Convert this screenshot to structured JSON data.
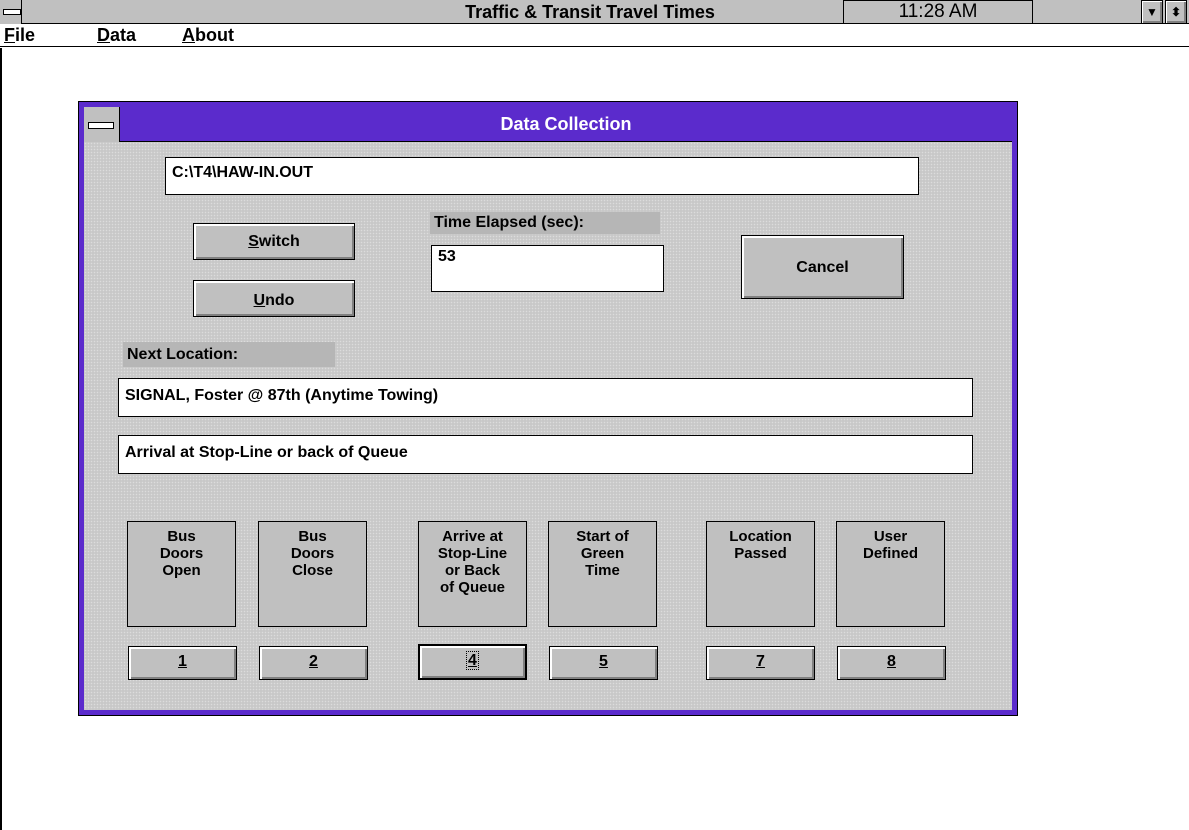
{
  "window": {
    "title": "Traffic & Transit Travel Times",
    "clock": "11:28 AM",
    "min_glyph": "▼",
    "max_glyph": "⬍"
  },
  "menu": [
    {
      "label": "File",
      "mnemonic": "F",
      "rest": "ile"
    },
    {
      "label": "Data",
      "mnemonic": "D",
      "rest": "ata"
    },
    {
      "label": "About",
      "mnemonic": "A",
      "rest": "bout"
    }
  ],
  "dialog": {
    "title": "Data Collection",
    "file_path": "C:\\T4\\HAW-IN.OUT",
    "time_label": "Time Elapsed (sec):",
    "time_value": "53",
    "switch_button": {
      "mnemonic": "S",
      "rest": "witch"
    },
    "undo_button": {
      "mnemonic": "U",
      "rest": "ndo"
    },
    "cancel_button": "Cancel",
    "next_location_label": "Next Location:",
    "location": "SIGNAL, Foster @ 87th (Anytime Towing)",
    "event": "Arrival at Stop-Line or back of Queue",
    "tiles": [
      {
        "label": "Bus\nDoors\nOpen",
        "key": "1"
      },
      {
        "label": "Bus\nDoors\nClose",
        "key": "2"
      },
      {
        "label": "Arrive at\nStop-Line\nor Back\nof Queue",
        "key": "4"
      },
      {
        "label": "Start of\nGreen\nTime",
        "key": "5"
      },
      {
        "label": "Location\nPassed",
        "key": "7"
      },
      {
        "label": "User\nDefined",
        "key": "8"
      }
    ]
  },
  "colors": {
    "dialog_titlebar": "#5b2bcc",
    "chrome_gray": "#c0c0c0"
  }
}
